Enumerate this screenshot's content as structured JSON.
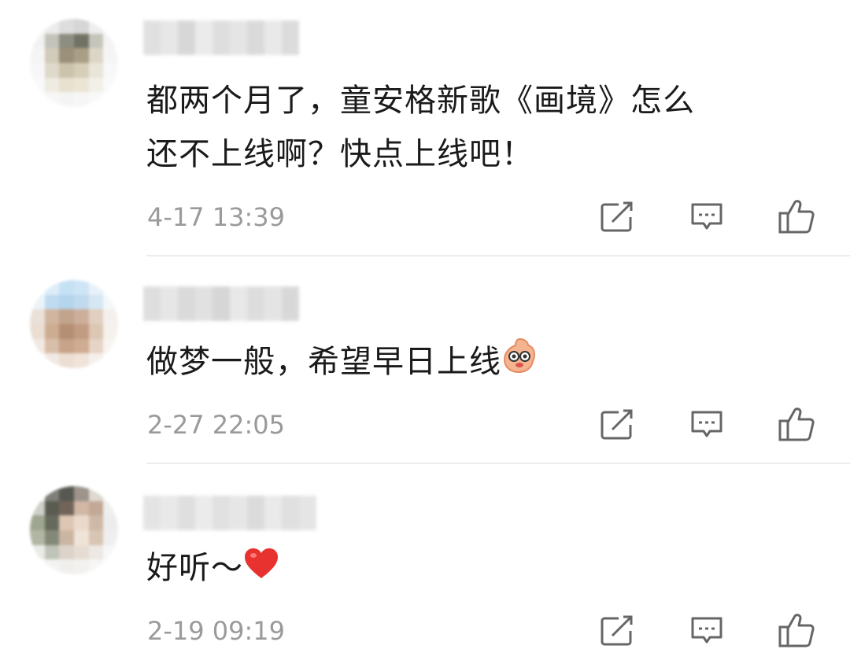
{
  "comments": [
    {
      "text_line1": "都两个月了，童安格新歌《画境》怎么",
      "text_line2": "还不上线啊？快点上线吧！",
      "time": "4-17 13:39",
      "avatar_colors": [
        "#f4f4f4",
        "#e9e9e9",
        "#d8d8d8",
        "#cfcfcf",
        "#ececec",
        "#f6f6f6",
        "#efefef",
        "#b9b9b0",
        "#7a7a6c",
        "#5a5a4a",
        "#bcbcb0",
        "#f2f2f2",
        "#f4f4f4",
        "#c9c2ad",
        "#8a7d62",
        "#9c8f72",
        "#d6d0be",
        "#f4f4f4",
        "#f6f6f6",
        "#d9d3c2",
        "#c4b99e",
        "#d0c6ad",
        "#e6e1d3",
        "#f7f7f7",
        "#f8f8f8",
        "#ece8dc",
        "#e4dcc8",
        "#e8e1cf",
        "#f1eee6",
        "#f9f9f9",
        "#fafafa",
        "#f6f6f6",
        "#f3f3f3",
        "#f5f5f5",
        "#f8f8f8",
        "#fbfbfb"
      ],
      "username_colors": [
        "#c8c8c8",
        "#d4d4d4",
        "#b8b8b8",
        "#dcdcdc",
        "#c4c4c4",
        "#d0d0d0",
        "#bcbcbc",
        "#d8d8d8",
        "#c0c0c0"
      ]
    },
    {
      "text": "做梦一般，希望早日上线",
      "time": "2-27 22:05",
      "avatar_colors": [
        "#f6f9fc",
        "#d8eaf7",
        "#bcdcf3",
        "#c6e1f4",
        "#e3eff9",
        "#f7fafd",
        "#e9f1f7",
        "#b3d5ef",
        "#a9cdea",
        "#b7d4ec",
        "#cfe3f3",
        "#f2f6fa",
        "#e6dcd2",
        "#c9a98e",
        "#b89377",
        "#c4a28a",
        "#dcc7b6",
        "#f3eeea",
        "#e7d9cc",
        "#c59f80",
        "#a97c5c",
        "#b88b6d",
        "#d7bda8",
        "#f4efea",
        "#efe6de",
        "#d2b49b",
        "#bd9475",
        "#c79e80",
        "#e2cdbd",
        "#f7f3ef",
        "#f9f7f5",
        "#efe6df",
        "#ead9cb",
        "#eedfd3",
        "#f5eee8",
        "#fbf9f7"
      ],
      "username_colors": [
        "#c4c4c4",
        "#d2d2d2",
        "#bdbdbd",
        "#cacaca",
        "#b6b6b6",
        "#d6d6d6",
        "#c2c2c2",
        "#cfcfcf",
        "#bababa"
      ]
    },
    {
      "text": "好听～",
      "time": "2-19 09:19",
      "avatar_colors": [
        "#f5f5f5",
        "#6a6a62",
        "#3c3c36",
        "#8c8278",
        "#d9d2c8",
        "#f3f3f3",
        "#c5c8bf",
        "#3e4034",
        "#5a4a3e",
        "#c9ab95",
        "#b99a84",
        "#ececec",
        "#8e967e",
        "#4c5140",
        "#d8bda6",
        "#e8d4c3",
        "#c7ad97",
        "#e9e9e9",
        "#a4ab94",
        "#6f7560",
        "#c3a993",
        "#eedfd2",
        "#d2bba7",
        "#ededed",
        "#e6e8e2",
        "#b5b9ac",
        "#d6cdc2",
        "#e3d7cc",
        "#eae5df",
        "#f6f6f6",
        "#fafafa",
        "#f2f2f0",
        "#eeedea",
        "#f0efec",
        "#f5f5f4",
        "#fbfbfb"
      ],
      "username_colors": [
        "#cfcfcf",
        "#d8d8d8",
        "#c6c6c6",
        "#dcdcdc",
        "#c9c9c9",
        "#d3d3d3",
        "#bfbfbf",
        "#d9d9d9",
        "#c7c7c7",
        "#d1d1d1"
      ]
    }
  ],
  "icons": {
    "share": "share-icon",
    "reply": "comment-icon",
    "like": "thumbs-up-icon"
  },
  "colors": {
    "text": "#1a1a1a",
    "timestamp": "#9a9a9a",
    "icon": "#666666",
    "divider": "#ececec",
    "heart": "#e8322f"
  }
}
